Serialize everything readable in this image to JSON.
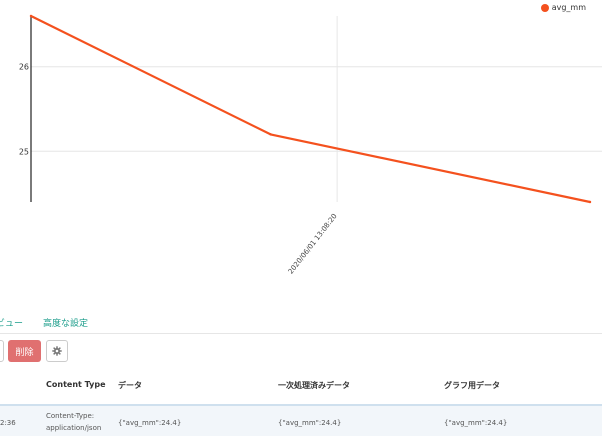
{
  "chart_data": {
    "type": "line",
    "series": [
      {
        "name": "avg_mm",
        "color": "#f4511e",
        "points": [
          {
            "x": "2020/06/01 12:30:00",
            "y": 26.6
          },
          {
            "x": "2020/06/01 13:00:00",
            "y": 25.2
          },
          {
            "x": "2020/06/01 13:40:00",
            "y": 24.4
          }
        ]
      }
    ],
    "x_ticks": [
      "2020/06/01 13:08:20"
    ],
    "y_ticks": [
      25,
      26
    ],
    "ylim": [
      24.4,
      26.6
    ],
    "grid": true,
    "legend_position": "top-right"
  },
  "legend": {
    "label": "avg_mm",
    "color": "#f4511e"
  },
  "subnav": {
    "preview_label": "ビュー",
    "advanced_label": "高度な設定"
  },
  "toolbar": {
    "delete_label": "削除"
  },
  "table": {
    "headers": {
      "content_type": "Content Type",
      "data": "データ",
      "processed": "一次処理済みデータ",
      "graph": "グラフ用データ"
    },
    "rows": [
      {
        "time": "2:36",
        "content_type": "Content-Type: application/json",
        "data": "{\"avg_mm\":24.4}",
        "processed": "{\"avg_mm\":24.4}",
        "graph": "{\"avg_mm\":24.4}"
      }
    ]
  }
}
